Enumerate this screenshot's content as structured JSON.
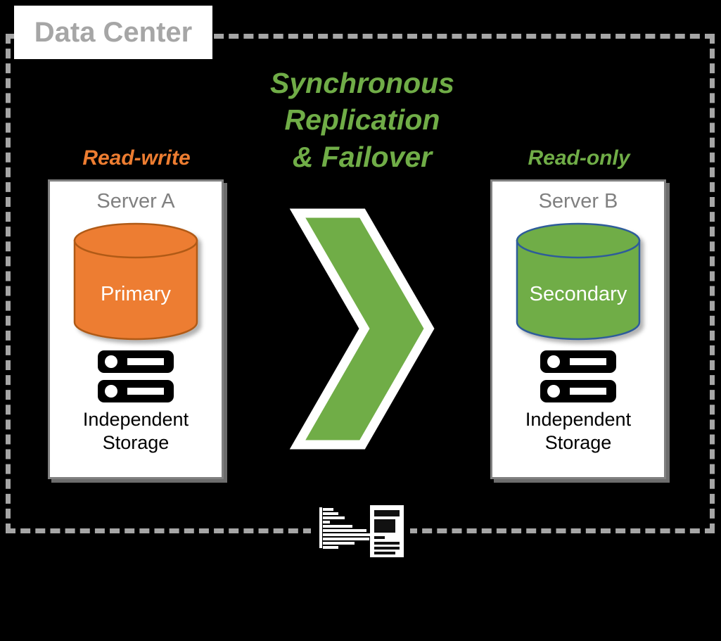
{
  "boundary": {
    "label": "Data Center",
    "label_color": "#a6a6a6",
    "border_color": "#a6a6a6",
    "style": "dashed"
  },
  "center": {
    "title_line1": "Synchronous",
    "title_line2": "Replication",
    "title_line3": "& Failover",
    "title_color": "#70ad47",
    "arrow_icon": "chevron-right-icon",
    "arrow_fill": "#70ad47",
    "arrow_outline": "#ffffff"
  },
  "left_node": {
    "role_label": "Read-write",
    "role_color": "#ed7d31",
    "server_title": "Server A",
    "server_title_color": "#808080",
    "database_label": "Primary",
    "database_fill": "#ed7d31",
    "database_stroke": "#b05a18",
    "database_icon": "database-cylinder-icon",
    "rack_icon": "server-rack-icon",
    "storage_line1": "Independent",
    "storage_line2": "Storage",
    "panel_border_color": "#808080",
    "panel_background": "#ffffff"
  },
  "right_node": {
    "role_label": "Read-only",
    "role_color": "#70ad47",
    "server_title": "Server B",
    "server_title_color": "#808080",
    "database_label": "Secondary",
    "database_fill": "#70ad47",
    "database_stroke": "#2e5c9a",
    "database_icon": "database-cylinder-icon",
    "rack_icon": "server-rack-icon",
    "storage_line1": "Independent",
    "storage_line2": "Storage",
    "panel_border_color": "#808080",
    "panel_background": "#ffffff"
  },
  "footer": {
    "icon": "report-chart-document-icon"
  }
}
